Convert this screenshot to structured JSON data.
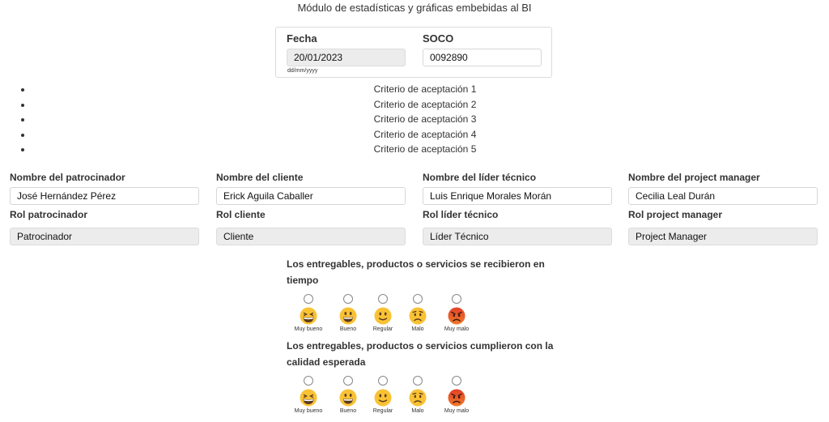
{
  "header": {
    "title": "Módulo de estadísticas y gráficas embebidas al BI"
  },
  "form": {
    "fecha_label": "Fecha",
    "fecha_value": "20/01/2023",
    "fecha_hint": "dd/mm/yyyy",
    "soco_label": "SOCO",
    "soco_value": "0092890"
  },
  "criteria": [
    "Criterio de aceptación 1",
    "Criterio de aceptación 2",
    "Criterio de aceptación 3",
    "Criterio de aceptación 4",
    "Criterio de aceptación 5"
  ],
  "people": [
    {
      "name_label": "Nombre del patrocinador",
      "name_value": "José Hernández Pérez",
      "role_label": "Rol patrocinador",
      "role_value": "Patrocinador"
    },
    {
      "name_label": "Nombre del cliente",
      "name_value": "Erick Aguila Caballer",
      "role_label": "Rol cliente",
      "role_value": "Cliente"
    },
    {
      "name_label": "Nombre del líder técnico",
      "name_value": "Luis Enrique Morales Morán",
      "role_label": "Rol líder técnico",
      "role_value": "Líder Técnico"
    },
    {
      "name_label": "Nombre del project manager",
      "name_value": "Cecilia Leal Durán",
      "role_label": "Rol project manager",
      "role_value": "Project Manager"
    }
  ],
  "questions": [
    {
      "text": "Los entregables, productos o servicios se recibieron en tiempo"
    },
    {
      "text": "Los entregables, productos o servicios cumplieron con la calidad esperada"
    }
  ],
  "rating_options": [
    {
      "label": "Muy bueno",
      "icon": "grinning-squint-face-icon"
    },
    {
      "label": "Bueno",
      "icon": "grinning-face-icon"
    },
    {
      "label": "Regular",
      "icon": "slightly-smiling-face-icon"
    },
    {
      "label": "Malo",
      "icon": "worried-face-icon"
    },
    {
      "label": "Muy malo",
      "icon": "angry-face-icon"
    }
  ]
}
